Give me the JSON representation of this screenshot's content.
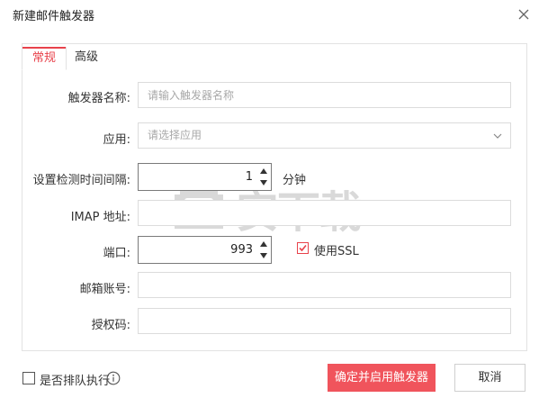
{
  "dialog": {
    "title": "新建邮件触发器",
    "close_icon": "close-icon"
  },
  "tabs": [
    {
      "label": "常规",
      "active": true
    },
    {
      "label": "高级",
      "active": false
    }
  ],
  "form": {
    "trigger_name": {
      "label": "触发器名称:",
      "placeholder": "请输入触发器名称",
      "value": ""
    },
    "app": {
      "label": "应用:",
      "placeholder": "请选择应用",
      "icon": "chevron-down-icon"
    },
    "interval": {
      "label": "设置检测时间间隔:",
      "value": "1",
      "unit": "分钟"
    },
    "imap": {
      "label": "IMAP 地址:",
      "value": ""
    },
    "port": {
      "label": "端口:",
      "value": "993"
    },
    "ssl": {
      "label": "使用SSL",
      "checked": true
    },
    "account": {
      "label": "邮箱账号:",
      "value": ""
    },
    "auth_code": {
      "label": "授权码:",
      "value": ""
    }
  },
  "footer": {
    "queue_label": "是否排队执行",
    "queue_checked": false,
    "info_icon": "info-icon",
    "confirm_label": "确定并启用触发器",
    "cancel_label": "取消"
  },
  "watermark": {
    "text": "安下载",
    "icon": "shield-icon"
  },
  "colors": {
    "accent": "#e8424b",
    "primary_button": "#f0545c"
  }
}
